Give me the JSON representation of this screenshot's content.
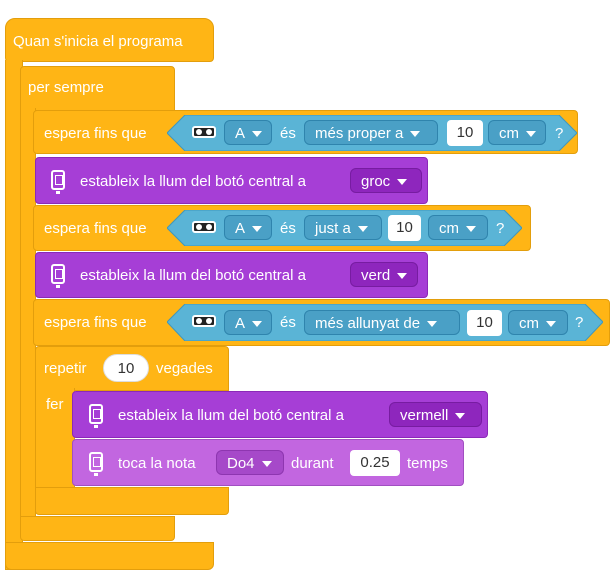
{
  "program": {
    "hat_label": "Quan s'inicia el programa",
    "forever_label": "per sempre",
    "wait1": {
      "prefix": "espera fins que",
      "port": "A",
      "verb": "és",
      "mode": "més proper a",
      "value": "10",
      "unit": "cm",
      "q": "?"
    },
    "light1": {
      "label": "estableix la llum del botó central a",
      "color": "groc"
    },
    "wait2": {
      "prefix": "espera fins que",
      "port": "A",
      "verb": "és",
      "mode": "just a",
      "value": "10",
      "unit": "cm",
      "q": "?"
    },
    "light2": {
      "label": "estableix la llum del botó central a",
      "color": "verd"
    },
    "wait3": {
      "prefix": "espera fins que",
      "port": "A",
      "verb": "és",
      "mode": "més allunyat de",
      "value": "10",
      "unit": "cm",
      "q": "?"
    },
    "repeat": {
      "label_before": "repetir",
      "count": "10",
      "label_after": "vegades",
      "do_label": "fer"
    },
    "light3": {
      "label": "estableix la llum del botó central a",
      "color": "vermell"
    },
    "note": {
      "label": "toca la nota",
      "note": "Do4",
      "during": "durant",
      "duration": "0.25",
      "unit": "temps"
    }
  },
  "colors": {
    "control": "#ffb515",
    "sensor": "#5ab4d6",
    "light": "#a63ed6",
    "sound": "#c266e0"
  },
  "icons": [
    "distance-sensor-icon",
    "hub-icon"
  ]
}
